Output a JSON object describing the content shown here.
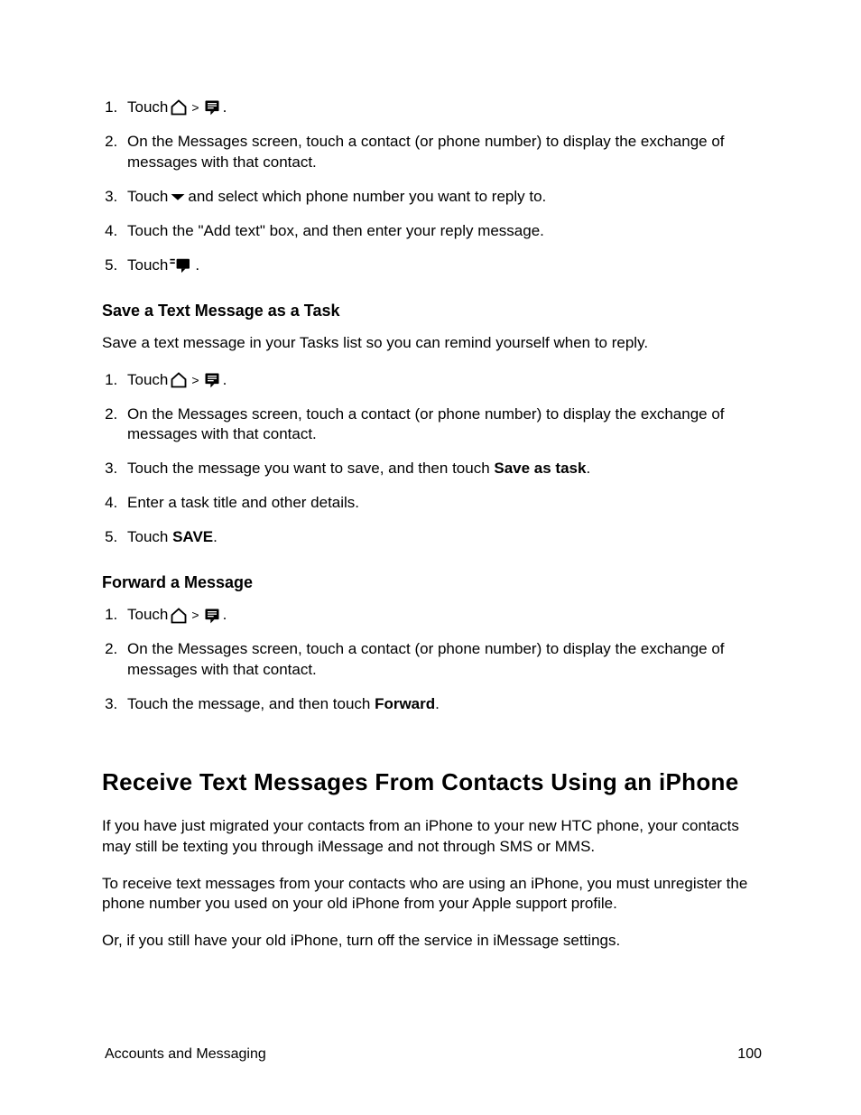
{
  "common": {
    "touch": "Touch",
    "gt": ">",
    "period": "."
  },
  "list1": {
    "i2": "On the Messages screen, touch a contact (or phone number) to display the exchange of messages with that contact.",
    "i3a": "Touch",
    "i3b": "and select which phone number you want to reply to.",
    "i4": "Touch the \"Add text\" box, and then enter your reply message.",
    "i5a": "Touch"
  },
  "sec_save": {
    "title": "Save a Text Message as a Task",
    "intro": "Save a text message in your Tasks list so you can remind yourself when to reply.",
    "i2": "On the Messages screen, touch a contact (or phone number) to display the exchange of messages with that contact.",
    "i3a": "Touch the message you want to save, and then touch ",
    "i3b": "Save as task",
    "i4": "Enter a task title and other details.",
    "i5a": "Touch ",
    "i5b": "SAVE"
  },
  "sec_forward": {
    "title": "Forward a Message",
    "i2": "On the Messages screen, touch a contact (or phone number) to display the exchange of messages with that contact.",
    "i3a": "Touch the message, and then touch ",
    "i3b": "Forward"
  },
  "sec_iphone": {
    "title": "Receive Text Messages From Contacts Using an iPhone",
    "p1": "If you have just migrated your contacts from an iPhone to your new HTC phone, your contacts may still be texting you through iMessage and not through SMS or MMS.",
    "p2": "To receive text messages from your contacts who are using an iPhone, you must unregister the phone number you used on your old iPhone from your Apple support profile.",
    "p3": "Or, if you still have your old iPhone, turn off the service in iMessage settings."
  },
  "footer": {
    "left": "Accounts and Messaging",
    "right": "100"
  }
}
